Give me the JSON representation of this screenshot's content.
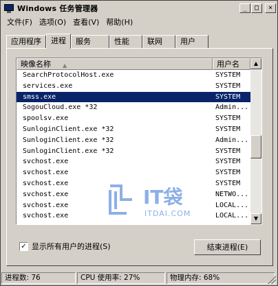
{
  "window": {
    "title": "Windows 任务管理器",
    "buttons": {
      "minimize": "_",
      "maximize": "□",
      "close": "×"
    }
  },
  "menu": [
    "文件(F)",
    "选项(O)",
    "查看(V)",
    "帮助(H)"
  ],
  "tabs": [
    "应用程序",
    "进程",
    "服务",
    "性能",
    "联网",
    "用户"
  ],
  "active_tab": "进程",
  "list": {
    "columns": [
      "映像名称",
      "用户名"
    ],
    "sort_indicator": "▲",
    "rows": [
      {
        "name": "SearchProtocolHost.exe",
        "user": "SYSTEM"
      },
      {
        "name": "services.exe",
        "user": "SYSTEM"
      },
      {
        "name": "smss.exe",
        "user": "SYSTEM",
        "selected": true
      },
      {
        "name": "SogouCloud.exe *32",
        "user": "Admin..."
      },
      {
        "name": "spoolsv.exe",
        "user": "SYSTEM"
      },
      {
        "name": "SunloginClient.exe *32",
        "user": "SYSTEM"
      },
      {
        "name": "SunloginClient.exe *32",
        "user": "Admin..."
      },
      {
        "name": "SunloginClient.exe *32",
        "user": "SYSTEM"
      },
      {
        "name": "svchost.exe",
        "user": "SYSTEM"
      },
      {
        "name": "svchost.exe",
        "user": "SYSTEM"
      },
      {
        "name": "svchost.exe",
        "user": "SYSTEM"
      },
      {
        "name": "svchost.exe",
        "user": "NETWO..."
      },
      {
        "name": "svchost.exe",
        "user": "LOCAL..."
      },
      {
        "name": "svchost.exe",
        "user": "LOCAL..."
      }
    ],
    "scroll": {
      "up": "▲",
      "down": "▼"
    }
  },
  "watermark": {
    "brand": "IT袋",
    "url": "ITDAI.COM"
  },
  "show_all_users": {
    "label": "显示所有用户的进程(S)",
    "checked": "✓"
  },
  "end_process_button": "结束进程(E)",
  "statusbar": {
    "processes": "进程数: 76",
    "cpu": "CPU 使用率: 27%",
    "memory": "物理内存: 68%"
  },
  "colors": {
    "selection": "#0a246a",
    "face": "#d4d0c8",
    "watermark": "#2f6fd6"
  }
}
